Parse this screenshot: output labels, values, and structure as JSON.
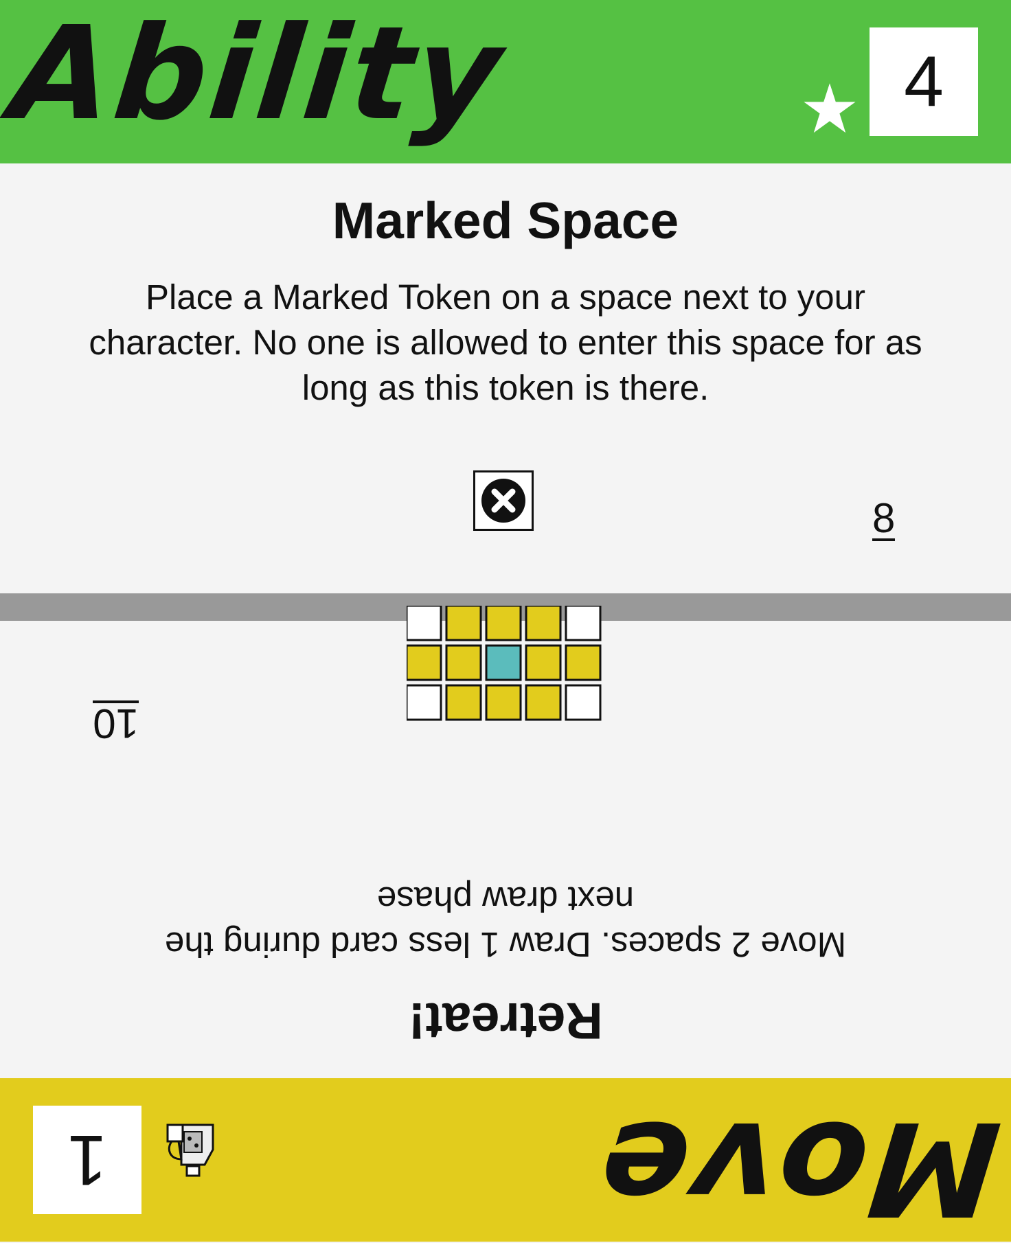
{
  "card": {
    "top": {
      "type_label": "Ability",
      "cost": "4",
      "title": "Marked Space",
      "description": "Place a Marked Token on a space next to your character. No one is allowed to enter this space for as long as this token is there.",
      "initiative": "8",
      "band_color": "#55c143",
      "icons": [
        "star-icon",
        "marked-token-icon"
      ]
    },
    "bottom": {
      "type_label": "Move",
      "cost": "1",
      "title": "Retreat!",
      "description": "Move 2 spaces. Draw 1 less card during the next draw phase",
      "initiative": "10",
      "band_color": "#e2cc1d",
      "icons": [
        "potion-icon"
      ],
      "range_grid": {
        "rows": [
          [
            "empty",
            "move",
            "move",
            "move",
            "empty"
          ],
          [
            "move",
            "move",
            "origin",
            "move",
            "move"
          ],
          [
            "empty",
            "move",
            "move",
            "move",
            "empty"
          ]
        ],
        "colors": {
          "empty": "#ffffff",
          "move": "#e2cc1d",
          "origin": "#5bbcbc"
        }
      }
    },
    "divider_color": "#999999"
  }
}
